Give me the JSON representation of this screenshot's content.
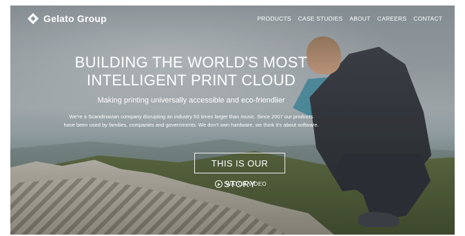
{
  "brand": {
    "name": "Gelato Group",
    "logo_icon": "gelato-diamond-logo"
  },
  "nav": {
    "items": [
      {
        "label": "PRODUCTS"
      },
      {
        "label": "CASE STUDIES"
      },
      {
        "label": "ABOUT"
      },
      {
        "label": "CAREERS"
      },
      {
        "label": "CONTACT"
      }
    ]
  },
  "hero": {
    "headline_line1": "BUILDING THE WORLD'S MOST",
    "headline_line2": "INTELLIGENT PRINT CLOUD",
    "subtitle": "Making printing universally accessible and eco-friendlier",
    "body_line1": "We're a Scandinavian company disrupting an industry 50 times larger than music. Since 2007 our products",
    "body_line2": "have been used by families, companies and governments. We don't own hardware, we think it's about software.",
    "cta_label": "THIS IS OUR STORY",
    "video_label": "WATCH VIDEO",
    "video_icon": "play-circle-icon"
  },
  "colors": {
    "text": "#ffffff",
    "accent_jacket": "#4f8fa0"
  }
}
